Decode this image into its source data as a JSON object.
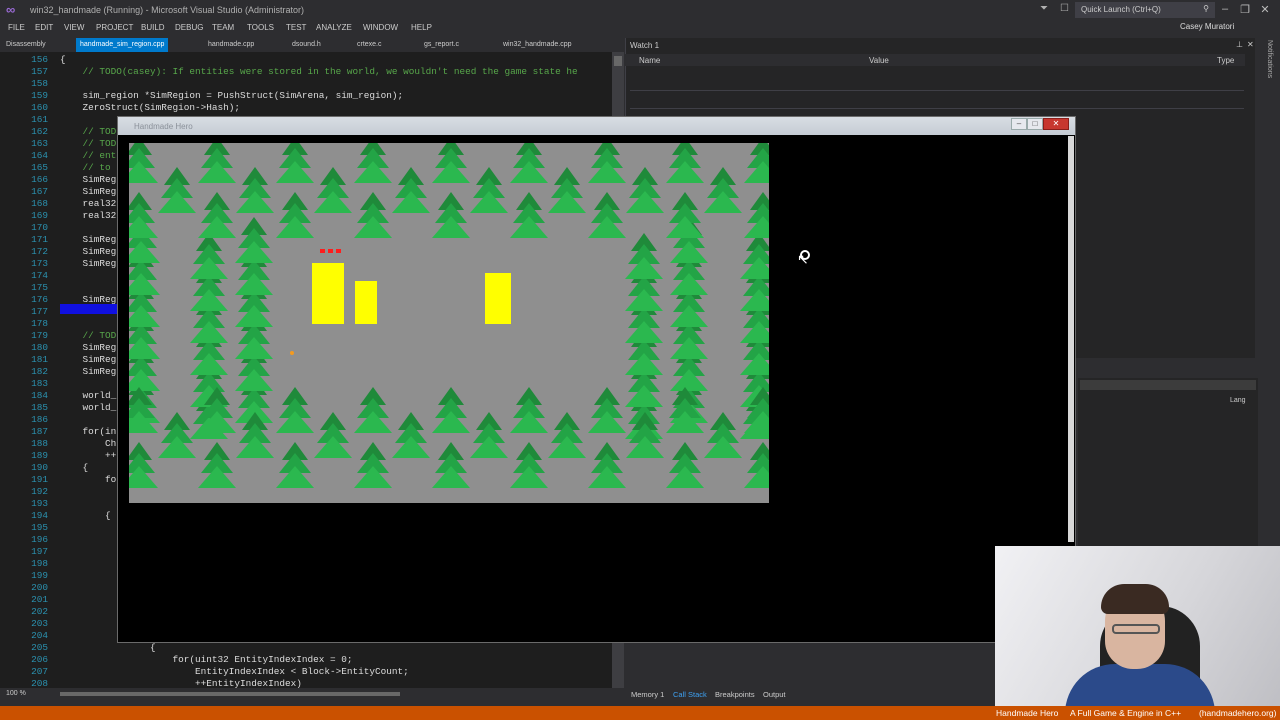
{
  "window": {
    "title": "win32_handmade (Running) - Microsoft Visual Studio (Administrator)",
    "quick_launch": "Quick Launch (Ctrl+Q)",
    "user": "Casey Muratori"
  },
  "menu": [
    "FILE",
    "EDIT",
    "VIEW",
    "PROJECT",
    "BUILD",
    "DEBUG",
    "TEAM",
    "TOOLS",
    "TEST",
    "ANALYZE",
    "WINDOW",
    "HELP"
  ],
  "tabs": [
    {
      "label": "Disassembly"
    },
    {
      "label": "handmade_sim_region.cpp",
      "active": true
    },
    {
      "label": "handmade.cpp"
    },
    {
      "label": "dsound.h"
    },
    {
      "label": "crtexe.c"
    },
    {
      "label": "gs_report.c"
    },
    {
      "label": "win32_handmade.cpp"
    }
  ],
  "code_lines": [
    {
      "n": "156",
      "t": "{",
      "c": "kw"
    },
    {
      "n": "157",
      "t": "    // TODO(casey): If entities were stored in the world, we wouldn't need the game state he",
      "c": "cm"
    },
    {
      "n": "158",
      "t": "",
      "c": "kw"
    },
    {
      "n": "159",
      "t": "    sim_region *SimRegion = PushStruct(SimArena, sim_region);",
      "c": "kw"
    },
    {
      "n": "160",
      "t": "    ZeroStruct(SimRegion->Hash);",
      "c": "kw"
    },
    {
      "n": "161",
      "t": "",
      "c": "kw"
    },
    {
      "n": "162",
      "t": "    // TOD",
      "c": "cm"
    },
    {
      "n": "163",
      "t": "    // TOD",
      "c": "cm"
    },
    {
      "n": "164",
      "t": "    // ent",
      "c": "cm"
    },
    {
      "n": "165",
      "t": "    // to",
      "c": "cm"
    },
    {
      "n": "166",
      "t": "    SimReg",
      "c": "kw"
    },
    {
      "n": "167",
      "t": "    SimReg",
      "c": "kw"
    },
    {
      "n": "168",
      "t": "    real32",
      "c": "kw"
    },
    {
      "n": "169",
      "t": "    real32",
      "c": "kw"
    },
    {
      "n": "170",
      "t": "",
      "c": "kw"
    },
    {
      "n": "171",
      "t": "    SimReg",
      "c": "kw"
    },
    {
      "n": "172",
      "t": "    SimReg",
      "c": "kw"
    },
    {
      "n": "173",
      "t": "    SimReg",
      "c": "kw"
    },
    {
      "n": "174",
      "t": "",
      "c": "kw"
    },
    {
      "n": "175",
      "t": "",
      "c": "kw"
    },
    {
      "n": "176",
      "t": "    SimReg",
      "c": "kw"
    },
    {
      "n": "177",
      "t": "",
      "c": "kw"
    },
    {
      "n": "178",
      "t": "",
      "c": "kw"
    },
    {
      "n": "179",
      "t": "    // TOD",
      "c": "cm"
    },
    {
      "n": "180",
      "t": "    SimReg",
      "c": "kw"
    },
    {
      "n": "181",
      "t": "    SimReg",
      "c": "kw"
    },
    {
      "n": "182",
      "t": "    SimReg",
      "c": "kw"
    },
    {
      "n": "183",
      "t": "",
      "c": "kw"
    },
    {
      "n": "184",
      "t": "    world_",
      "c": "kw"
    },
    {
      "n": "185",
      "t": "    world_",
      "c": "kw"
    },
    {
      "n": "186",
      "t": "",
      "c": "kw"
    },
    {
      "n": "187",
      "t": "    for(in",
      "c": "kw"
    },
    {
      "n": "188",
      "t": "        Ch",
      "c": "kw"
    },
    {
      "n": "189",
      "t": "        ++",
      "c": "kw"
    },
    {
      "n": "190",
      "t": "    {",
      "c": "kw"
    },
    {
      "n": "191",
      "t": "        fo",
      "c": "kw"
    },
    {
      "n": "192",
      "t": "",
      "c": "kw"
    },
    {
      "n": "193",
      "t": "",
      "c": "kw"
    },
    {
      "n": "194",
      "t": "        {",
      "c": "kw"
    },
    {
      "n": "195",
      "t": "",
      "c": "kw"
    },
    {
      "n": "196",
      "t": "",
      "c": "kw"
    },
    {
      "n": "197",
      "t": "",
      "c": "kw"
    },
    {
      "n": "198",
      "t": "",
      "c": "kw"
    },
    {
      "n": "199",
      "t": "",
      "c": "kw"
    },
    {
      "n": "200",
      "t": "",
      "c": "kw"
    },
    {
      "n": "201",
      "t": "",
      "c": "kw"
    },
    {
      "n": "202",
      "t": "",
      "c": "kw"
    },
    {
      "n": "203",
      "t": "",
      "c": "kw"
    },
    {
      "n": "204",
      "t": "",
      "c": "kw"
    },
    {
      "n": "205",
      "t": "                {",
      "c": "kw"
    },
    {
      "n": "206",
      "t": "                    for(uint32 EntityIndexIndex = 0;",
      "c": "kw"
    },
    {
      "n": "207",
      "t": "                        EntityIndexIndex < Block->EntityCount;",
      "c": "kw"
    },
    {
      "n": "208",
      "t": "                        ++EntityIndexIndex)",
      "c": "kw"
    }
  ],
  "watch": {
    "title": "Watch 1",
    "col_name": "Name",
    "col_value": "Value",
    "col_type": "Type"
  },
  "lang_label": "Lang",
  "notifications_label": "Notifications",
  "status": {
    "zoom": "100 %"
  },
  "bottom_tabs": [
    "Memory 1",
    "Call Stack",
    "Breakpoints",
    "Output"
  ],
  "game_window": {
    "title": "Handmade Hero"
  },
  "caption": {
    "left": "Handmade Hero",
    "center": "A Full Game & Engine in C++",
    "right": "(handmadehero.org)"
  },
  "colors": {
    "accent": "#007acc",
    "orange_bar": "#ca5100",
    "block": "#ffff00",
    "ground": "#8f8f8f"
  }
}
